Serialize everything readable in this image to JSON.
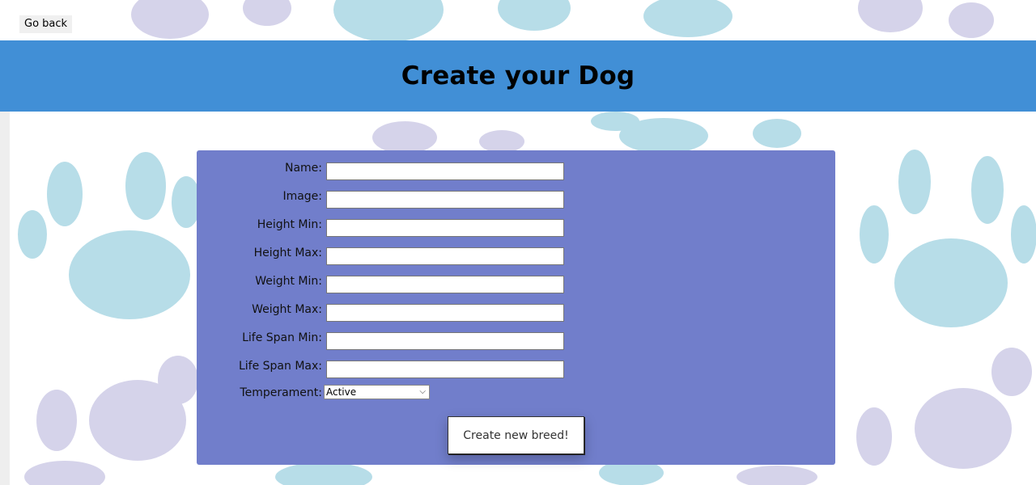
{
  "nav": {
    "go_back_label": "Go back"
  },
  "header": {
    "title": "Create your Dog"
  },
  "form": {
    "fields": [
      {
        "label": "Name:",
        "value": ""
      },
      {
        "label": "Image:",
        "value": ""
      },
      {
        "label": "Height Min:",
        "value": ""
      },
      {
        "label": "Height Max:",
        "value": ""
      },
      {
        "label": "Weight Min:",
        "value": ""
      },
      {
        "label": "Weight Max:",
        "value": ""
      },
      {
        "label": "Life Span Min:",
        "value": ""
      },
      {
        "label": "Life Span Max:",
        "value": ""
      }
    ],
    "temperament": {
      "label": "Temperament:",
      "selected": "Active"
    },
    "submit_label": "Create new breed!"
  },
  "colors": {
    "header_bg": "#418fd6",
    "panel_bg": "#717ecb",
    "paw_blue": "#b7dde8",
    "paw_lavender": "#d5d3ea"
  },
  "icons": {
    "select_chevron": "chevron-down-icon"
  }
}
